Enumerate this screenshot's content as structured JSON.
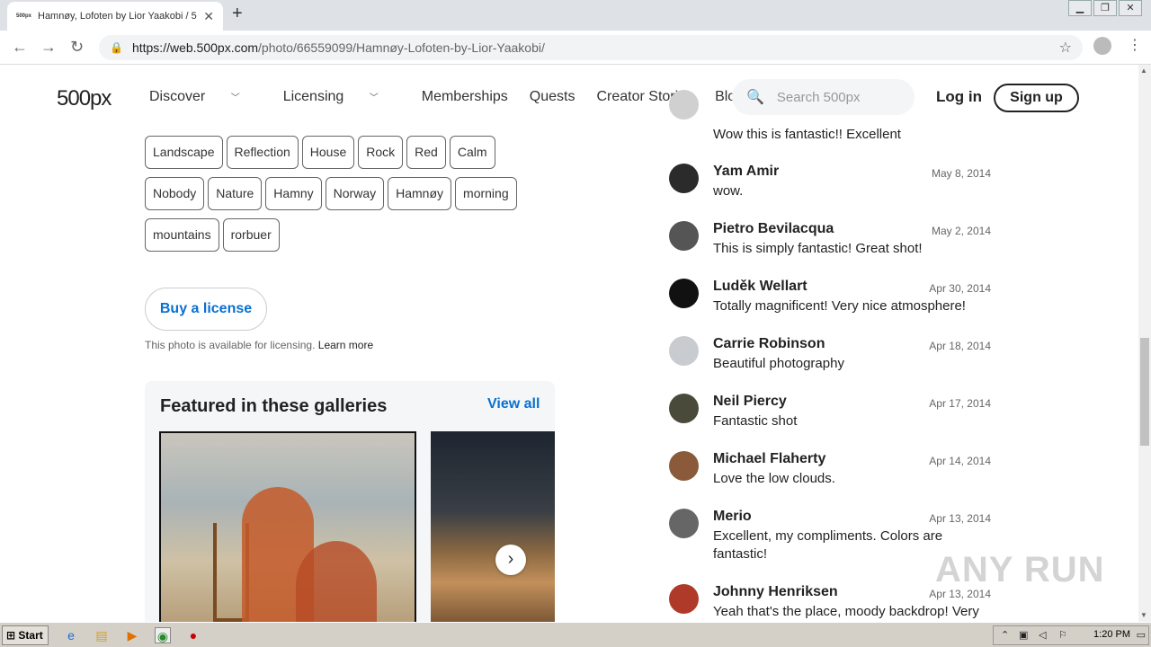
{
  "browser": {
    "tab_title": "Hamnøy, Lofoten by Lior Yaakobi / 5",
    "favicon_text": "500px",
    "url_host": "https://web.500px.com",
    "url_path": "/photo/66559099/Hamnøy-Lofoten-by-Lior-Yaakobi/"
  },
  "site_nav": {
    "logo": "500px",
    "items": [
      {
        "label": "Discover",
        "dropdown": true
      },
      {
        "label": "Licensing",
        "dropdown": true
      },
      {
        "label": "Memberships",
        "dropdown": false
      },
      {
        "label": "Quests",
        "dropdown": false
      },
      {
        "label": "Creator Stories",
        "dropdown": false
      },
      {
        "label": "Blog",
        "dropdown": false
      }
    ],
    "search_placeholder": "Search 500px",
    "login": "Log in",
    "signup": "Sign up"
  },
  "tags": [
    [
      "Landscape",
      "Reflection",
      "House",
      "Rock",
      "Red",
      "Calm"
    ],
    [
      "Nobody",
      "Nature",
      "Hamny",
      "Norway",
      "Hamnøy",
      "morning"
    ],
    [
      "mountains",
      "rorbuer"
    ]
  ],
  "license": {
    "button": "Buy a license",
    "note": "This photo is available for licensing.",
    "learn_more": "Learn more"
  },
  "galleries": {
    "title": "Featured in these galleries",
    "view_all": "View all"
  },
  "comments": [
    {
      "name": "",
      "date": "",
      "text": "Wow this is fantastic!! Excellent",
      "avatar_color": "#d0d0d0"
    },
    {
      "name": "Yam Amir",
      "date": "May 8, 2014",
      "text": "wow.",
      "avatar_color": "#2b2b2b"
    },
    {
      "name": "Pietro Bevilacqua",
      "date": "May 2, 2014",
      "text": "This is simply fantastic! Great shot!",
      "avatar_color": "#555555"
    },
    {
      "name": "Luděk Wellart",
      "date": "Apr 30, 2014",
      "text": "Totally magnificent! Very nice atmosphere!",
      "avatar_color": "#111111"
    },
    {
      "name": "Carrie Robinson",
      "date": "Apr 18, 2014",
      "text": "Beautiful photography",
      "avatar_color": "#c8ccd0"
    },
    {
      "name": "Neil Piercy",
      "date": "Apr 17, 2014",
      "text": "Fantastic shot",
      "avatar_color": "#4a4a3a"
    },
    {
      "name": "Michael Flaherty",
      "date": "Apr 14, 2014",
      "text": "Love the low clouds.",
      "avatar_color": "#8a5a3a"
    },
    {
      "name": "Merio",
      "date": "Apr 13, 2014",
      "text": "Excellent, my compliments. Colors are fantastic!",
      "avatar_color": "#666666"
    },
    {
      "name": "Johnny Henriksen",
      "date": "Apr 13, 2014",
      "text": "Yeah that's the place, moody backdrop! Very",
      "avatar_color": "#b03a2a"
    }
  ],
  "taskbar": {
    "start": "Start",
    "clock": "1:20 PM"
  },
  "watermark": "ANY RUN"
}
